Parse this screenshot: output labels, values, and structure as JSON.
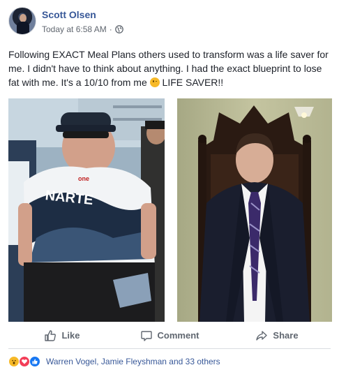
{
  "post": {
    "author": "Scott Olsen",
    "timestamp": "Today at 6:58 AM",
    "separator": "·",
    "privacy_icon": "globe-icon",
    "text_before_emoji": "Following EXACT Meal Plans others used to transform was a life saver for me. I didn't have to think about anything. I had the exact blueprint to lose fat with me. It's a 10/10 from me ",
    "emoji": "winking-face",
    "text_after_emoji": " LIFE SAVER!!",
    "photos": [
      {
        "name": "before-photo",
        "jersey_text": "NARTE",
        "logo_text": "one"
      },
      {
        "name": "after-photo"
      }
    ]
  },
  "actions": {
    "like_label": "Like",
    "comment_label": "Comment",
    "share_label": "Share"
  },
  "reactions": {
    "types": [
      "wow",
      "love",
      "like"
    ],
    "summary": "Warren Vogel, Jamie Fleyshman and 33 others"
  },
  "colors": {
    "link": "#385898",
    "meta": "#616770",
    "text": "#1d2129",
    "action": "#606770",
    "love": "#f33e58",
    "like": "#1877f2",
    "wow": "#f7b928"
  }
}
